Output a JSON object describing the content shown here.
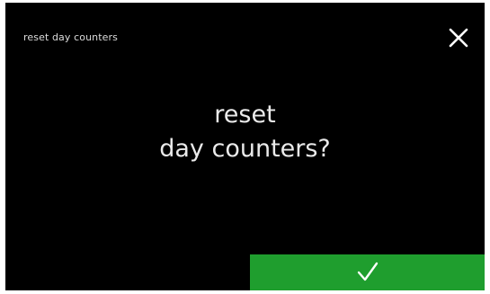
{
  "header": {
    "title": "reset day counters",
    "close_icon": "close-icon"
  },
  "dialog": {
    "prompt_line_1": "reset",
    "prompt_line_2": "day counters?"
  },
  "actions": {
    "confirm_icon": "check-icon"
  },
  "colors": {
    "background": "#000000",
    "text": "#eaeaea",
    "confirm_button": "#1f9e2e"
  }
}
